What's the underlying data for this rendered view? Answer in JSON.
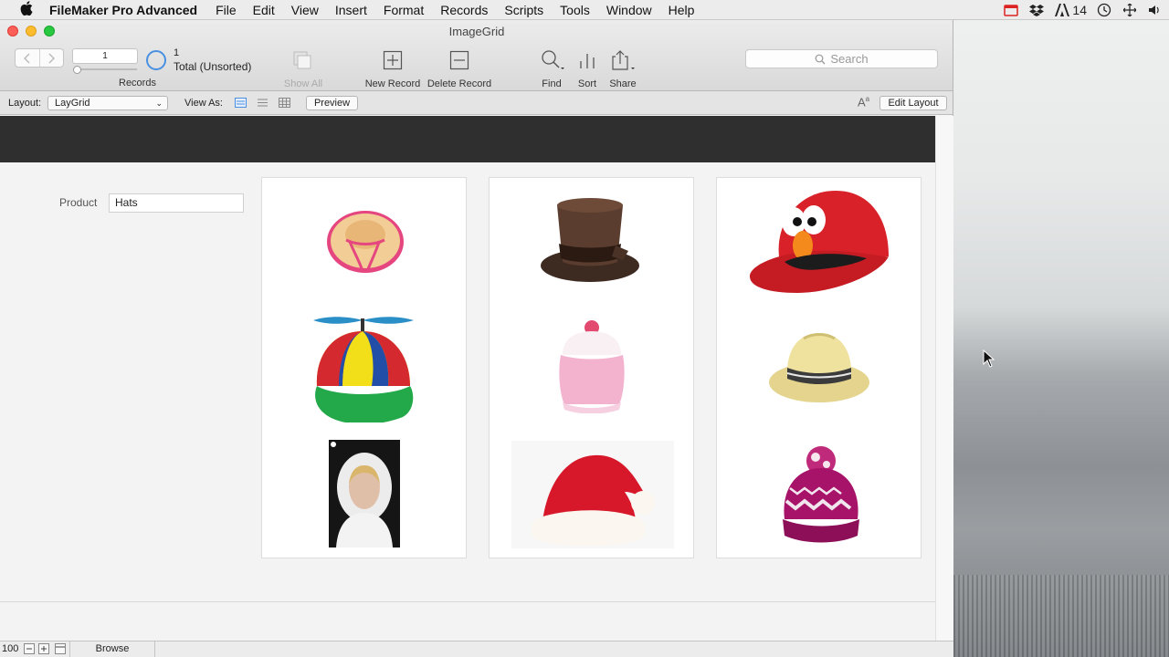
{
  "menubar": {
    "app_name": "FileMaker Pro Advanced",
    "items": [
      "File",
      "Edit",
      "View",
      "Insert",
      "Format",
      "Records",
      "Scripts",
      "Tools",
      "Window",
      "Help"
    ],
    "status_number": "14"
  },
  "window": {
    "title": "ImageGrid"
  },
  "toolbar": {
    "record_number": "1",
    "records_label": "Records",
    "found_count": "1",
    "found_total": "Total (Unsorted)",
    "show_all_label": "Show All",
    "new_record_label": "New Record",
    "delete_record_label": "Delete Record",
    "find_label": "Find",
    "sort_label": "Sort",
    "share_label": "Share",
    "search_placeholder": "Search"
  },
  "layoutbar": {
    "layout_label": "Layout:",
    "layout_value": "LayGrid",
    "view_as_label": "View As:",
    "preview_label": "Preview",
    "edit_layout_label": "Edit Layout"
  },
  "record": {
    "product_label": "Product",
    "product_value": "Hats"
  },
  "grid": {
    "items": [
      "sun-hat",
      "top-hat",
      "elmo-cap",
      "propeller-beanie",
      "pink-beanie",
      "fedora",
      "fur-hood-photo",
      "santa-hat",
      "pom-pom-beanie"
    ]
  },
  "statusbar": {
    "zoom": "100",
    "mode": "Browse"
  },
  "colors": {
    "accent": "#4a90e2",
    "header_band": "#2f2f2f"
  }
}
